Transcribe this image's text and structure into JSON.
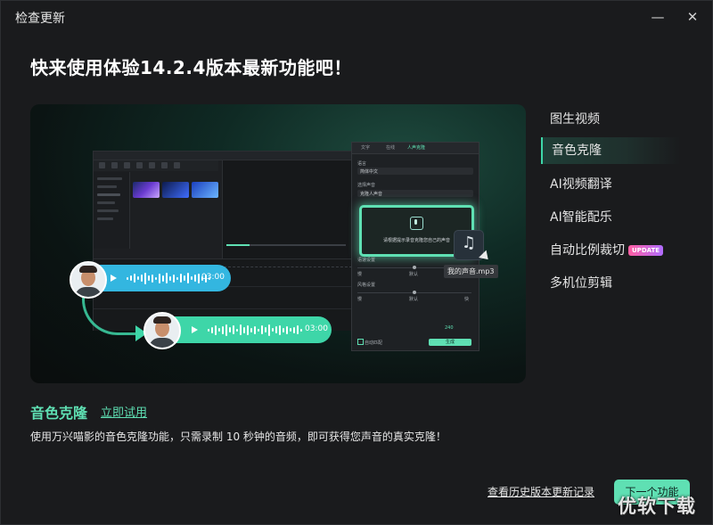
{
  "window": {
    "title": "检查更新",
    "minimize_glyph": "—",
    "close_glyph": "✕"
  },
  "headline": "快来使用体验14.2.4版本最新功能吧！",
  "preview": {
    "panel": {
      "tabs": [
        "文字",
        "在线",
        "人声克隆"
      ],
      "language_label": "语言",
      "language_value": "简体中文",
      "voice_label": "选择声音",
      "voice_value": "克隆人声音",
      "record_hint": "请根据提示录音克隆您自己的声音",
      "speed_label": "语速设置",
      "pitch_label": "风格设置",
      "slider_left": "慢",
      "slider_mid": "默认",
      "slider_right": "快",
      "auto_align_label": "自动匹配",
      "generate_label": "生成",
      "credits": "240"
    },
    "music_icon": "music-note-icon",
    "music_caption": "我的声音.mp3",
    "original_clip_time": "03:00",
    "cloned_clip_time": "03:00",
    "accent_blue": "#33b6e0",
    "accent_green": "#3ed6a8"
  },
  "menu": {
    "items": [
      {
        "label": "图生视频",
        "active": false
      },
      {
        "label": "音色克隆",
        "active": true
      },
      {
        "label": "AI视频翻译",
        "active": false
      },
      {
        "label": "AI智能配乐",
        "active": false
      },
      {
        "label": "自动比例裁切",
        "active": false
      },
      {
        "label": "多机位剪辑",
        "active": false
      }
    ],
    "update_badge": "UPDATE"
  },
  "feature": {
    "title": "音色克隆",
    "try_link": "立即试用",
    "description": "使用万兴喵影的音色克隆功能，只需录制 10 秒钟的音频，即可获得您声音的真实克隆！"
  },
  "footer": {
    "history_link": "查看历史版本更新记录",
    "next_button": "下一个功能"
  },
  "watermark": "优软下载",
  "colors": {
    "accent": "#5fe0b3",
    "background": "#1a1b1d"
  }
}
